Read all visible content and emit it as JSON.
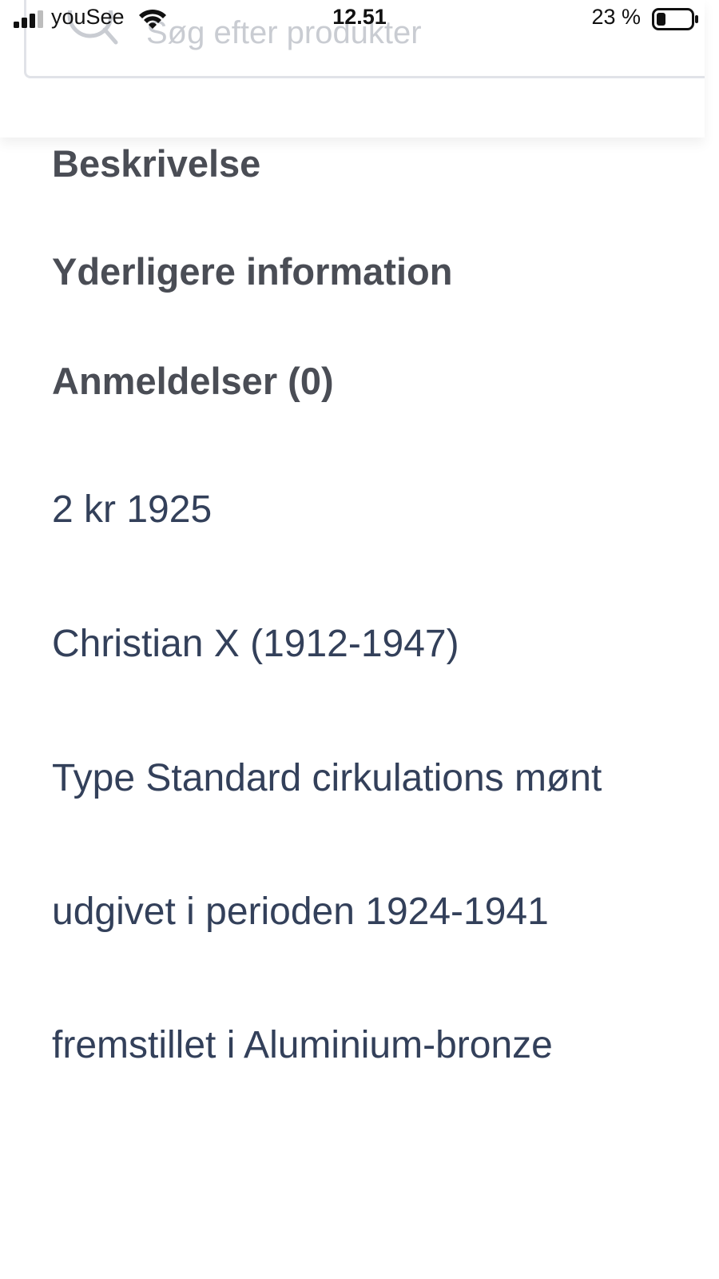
{
  "status_bar": {
    "carrier": "youSee",
    "time": "12.51",
    "battery_percent": "23 %"
  },
  "search": {
    "placeholder": "Søg efter produkter"
  },
  "tabs": [
    {
      "label": "Beskrivelse"
    },
    {
      "label": "Yderligere information"
    },
    {
      "label": "Anmeldelser (0)"
    }
  ],
  "description": {
    "lines": [
      "2 kr 1925",
      "Christian X (1912-1947)",
      "Type Standard cirkulations mønt",
      "udgivet i perioden 1924-1941",
      "fremstillet i Aluminium-bronze"
    ]
  }
}
